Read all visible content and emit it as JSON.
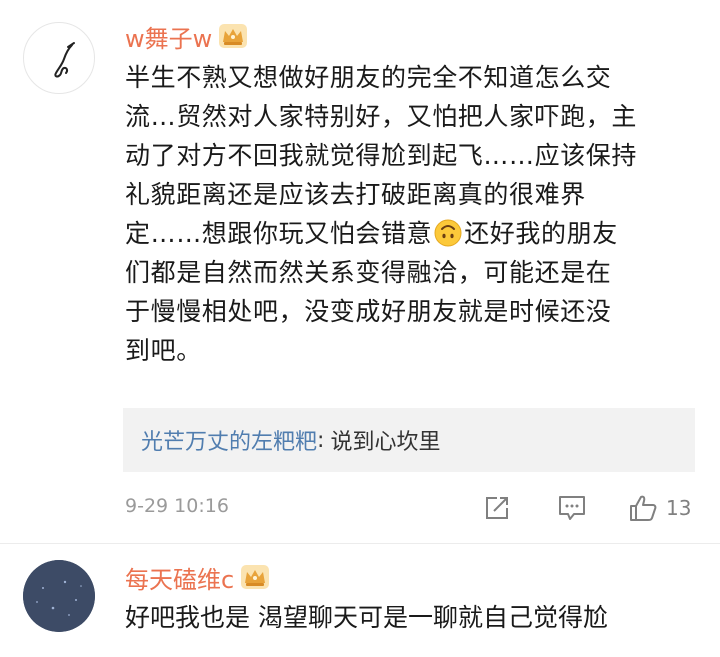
{
  "comments": [
    {
      "username": "w舞子w",
      "badge": "crown-icon",
      "lines": [
        "半生不熟又想做好朋友的完全不知道怎么交",
        "流…贸然对人家特别好，又怕把人家吓跑，主",
        "动了对方不回我就觉得尬到起飞……应该保持",
        "礼貌距离还是应该去打破距离真的很难界"
      ],
      "line5_before_emoji": "定……想跟你玩又怕会错意",
      "line5_after_emoji": "还好我的朋友",
      "lines_after": [
        "们都是自然而然关系变得融洽，可能还是在",
        "于慢慢相处吧，没变成好朋友就是时候还没",
        "到吧。"
      ],
      "reply": {
        "user": "光芒万丈的左粑粑",
        "separator": ":",
        "text": "说到心坎里"
      },
      "timestamp": "9-29 10:16",
      "like_count": "13"
    },
    {
      "username": "每天磕维c",
      "badge": "crown-icon",
      "text": "好吧我也是 渴望聊天可是一聊就自己觉得尬"
    }
  ],
  "colors": {
    "username": "#eb7350",
    "reply_user": "#507daf",
    "reply_bg": "#f2f2f2",
    "crown": "#e8a33a"
  }
}
